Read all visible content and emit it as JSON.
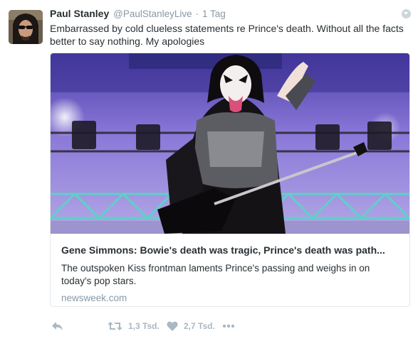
{
  "tweet": {
    "author": {
      "name": "Paul Stanley",
      "handle": "@PaulStanleyLive",
      "separator": "·",
      "time": "1 Tag"
    },
    "text": "Embarrassed by cold clueless statements re Prince's death. Without all the facts better to say nothing. My apologies"
  },
  "card": {
    "title": "Gene Simmons: Bowie's death was tragic, Prince's death was path...",
    "description": "The outspoken Kiss frontman laments Prince's passing and weighs in on today's pop stars.",
    "domain": "newsweek.com"
  },
  "actions": {
    "retweet_count": "1,3 Tsd.",
    "like_count": "2,7 Tsd."
  },
  "icons": {
    "reply": "reply-icon",
    "retweet": "retweet-icon",
    "like": "heart-icon",
    "more": "more-icon",
    "menu": "chevron-down-icon"
  },
  "colors": {
    "text": "#292f33",
    "muted": "#8899a6",
    "action_icon": "#aab8c2",
    "card_border": "#e1e8ed"
  }
}
